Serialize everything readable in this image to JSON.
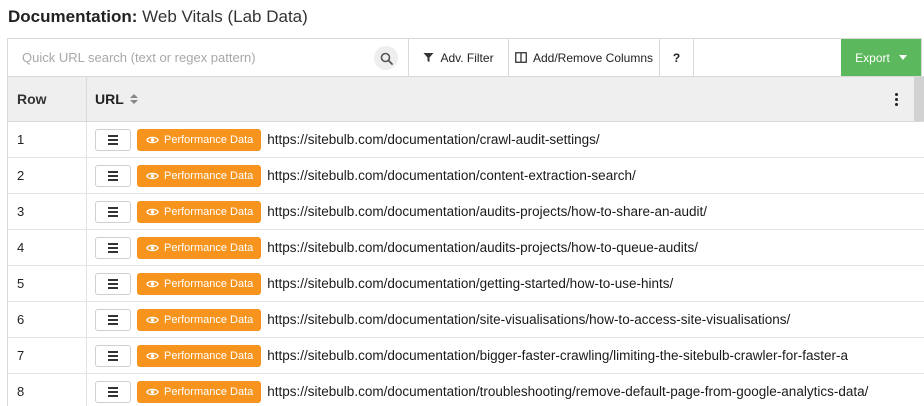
{
  "header": {
    "title_bold": "Documentation:",
    "title_rest": "Web Vitals (Lab Data)"
  },
  "toolbar": {
    "search_placeholder": "Quick URL search (text or regex pattern)",
    "filter_label": "Adv. Filter",
    "columns_label": "Add/Remove Columns",
    "help_label": "?",
    "export_label": "Export"
  },
  "colors": {
    "export": "#5cb85c",
    "performance_button": "#f7941d"
  },
  "table": {
    "columns": {
      "row": "Row",
      "url": "URL"
    },
    "performance_label": "Performance Data",
    "rows": [
      {
        "num": "1",
        "url": "https://sitebulb.com/documentation/crawl-audit-settings/"
      },
      {
        "num": "2",
        "url": "https://sitebulb.com/documentation/content-extraction-search/"
      },
      {
        "num": "3",
        "url": "https://sitebulb.com/documentation/audits-projects/how-to-share-an-audit/"
      },
      {
        "num": "4",
        "url": "https://sitebulb.com/documentation/audits-projects/how-to-queue-audits/"
      },
      {
        "num": "5",
        "url": "https://sitebulb.com/documentation/getting-started/how-to-use-hints/"
      },
      {
        "num": "6",
        "url": "https://sitebulb.com/documentation/site-visualisations/how-to-access-site-visualisations/"
      },
      {
        "num": "7",
        "url": "https://sitebulb.com/documentation/bigger-faster-crawling/limiting-the-sitebulb-crawler-for-faster-a"
      },
      {
        "num": "8",
        "url": "https://sitebulb.com/documentation/troubleshooting/remove-default-page-from-google-analytics-data/"
      }
    ]
  }
}
